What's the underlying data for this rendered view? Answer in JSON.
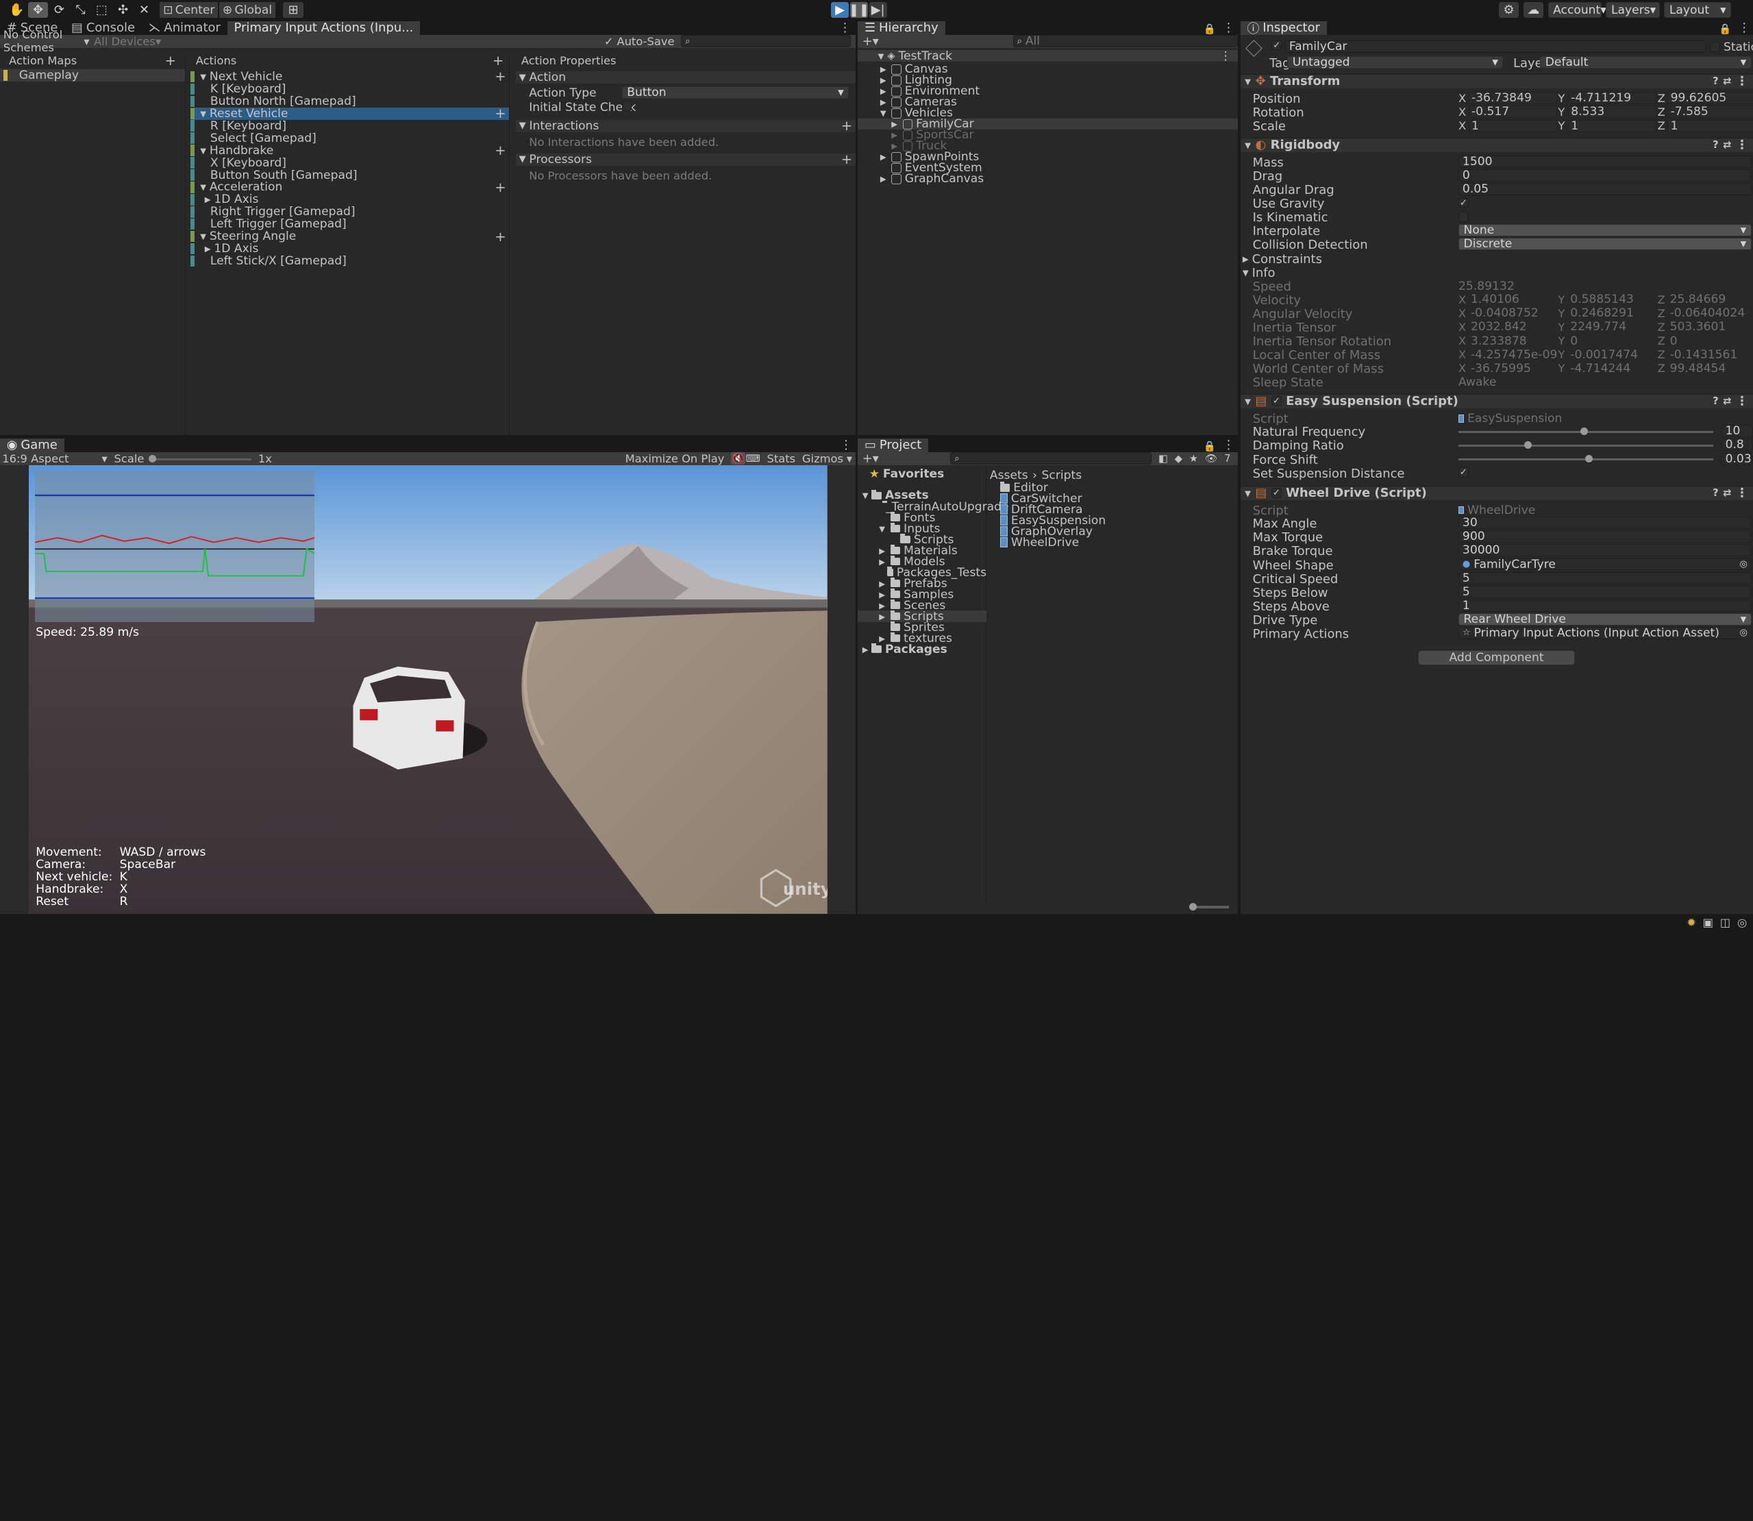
{
  "toolbar": {
    "center": "Center",
    "global": "Global",
    "account": "Account",
    "layers": "Layers",
    "layout": "Layout"
  },
  "tabs_top": {
    "scene": "Scene",
    "console": "Console",
    "animator": "Animator",
    "input_actions": "Primary Input Actions (Inpu..."
  },
  "input_editor": {
    "control_schemes": "No Control Schemes",
    "all_devices": "All Devices",
    "auto_save": "Auto-Save",
    "action_maps_header": "Action Maps",
    "actions_header": "Actions",
    "properties_header": "Action Properties",
    "action_map": "Gameplay",
    "actions": [
      {
        "t": "action",
        "label": "Next Vehicle"
      },
      {
        "t": "binding",
        "label": "K [Keyboard]"
      },
      {
        "t": "binding",
        "label": "Button North [Gamepad]"
      },
      {
        "t": "action",
        "label": "Reset Vehicle",
        "selected": true
      },
      {
        "t": "binding",
        "label": "R [Keyboard]"
      },
      {
        "t": "binding",
        "label": "Select [Gamepad]"
      },
      {
        "t": "action",
        "label": "Handbrake"
      },
      {
        "t": "binding",
        "label": "X [Keyboard]"
      },
      {
        "t": "binding",
        "label": "Button South [Gamepad]"
      },
      {
        "t": "action",
        "label": "Acceleration"
      },
      {
        "t": "composite",
        "label": "1D Axis"
      },
      {
        "t": "binding",
        "label": "Right Trigger [Gamepad]"
      },
      {
        "t": "binding",
        "label": "Left Trigger [Gamepad]"
      },
      {
        "t": "action",
        "label": "Steering Angle"
      },
      {
        "t": "composite",
        "label": "1D Axis"
      },
      {
        "t": "binding",
        "label": "Left Stick/X [Gamepad]"
      }
    ],
    "props": {
      "action_section": "Action",
      "action_type_label": "Action Type",
      "action_type_value": "Button",
      "initial_state_check": "Initial State Check",
      "interactions": "Interactions",
      "no_interactions": "No Interactions have been added.",
      "processors": "Processors",
      "no_processors": "No Processors have been added."
    }
  },
  "hierarchy": {
    "title": "Hierarchy",
    "search_placeholder": "All",
    "root": "TestTrack",
    "items": [
      "Canvas",
      "Lighting",
      "Environment",
      "Cameras",
      "Vehicles",
      "FamilyCar",
      "SportsCar",
      "Truck",
      "SpawnPoints",
      "EventSystem",
      "GraphCanvas"
    ]
  },
  "game": {
    "title": "Game",
    "aspect": "16:9 Aspect",
    "scale_label": "Scale",
    "scale_value": "1x",
    "maximize": "Maximize On Play",
    "stats": "Stats",
    "gizmos": "Gizmos",
    "speed": "Speed: 25.89 m/s",
    "controls": [
      [
        "Movement:",
        "WASD / arrows"
      ],
      [
        "Camera:",
        "SpaceBar"
      ],
      [
        "Next vehicle:",
        "K"
      ],
      [
        "Handbrake:",
        "X"
      ],
      [
        "Reset",
        "R"
      ]
    ],
    "watermark": "unity"
  },
  "project": {
    "title": "Project",
    "favorites": "Favorites",
    "assets": "Assets",
    "tree": [
      {
        "l": "_TerrainAutoUpgrade",
        "d": 1
      },
      {
        "l": "Fonts",
        "d": 1
      },
      {
        "l": "Inputs",
        "d": 1
      },
      {
        "l": "Scripts",
        "d": 2
      },
      {
        "l": "Materials",
        "d": 1
      },
      {
        "l": "Models",
        "d": 1
      },
      {
        "l": "Packages_Tests",
        "d": 1
      },
      {
        "l": "Prefabs",
        "d": 1
      },
      {
        "l": "Samples",
        "d": 1
      },
      {
        "l": "Scenes",
        "d": 1
      },
      {
        "l": "Scripts",
        "d": 1
      },
      {
        "l": "Sprites",
        "d": 1
      },
      {
        "l": "textures",
        "d": 1
      }
    ],
    "packages": "Packages",
    "breadcrumb_root": "Assets",
    "breadcrumb_leaf": "Scripts",
    "files": [
      {
        "l": "Editor",
        "k": "folder"
      },
      {
        "l": "CarSwitcher",
        "k": "script"
      },
      {
        "l": "DriftCamera",
        "k": "script"
      },
      {
        "l": "EasySuspension",
        "k": "script"
      },
      {
        "l": "GraphOverlay",
        "k": "script"
      },
      {
        "l": "WheelDrive",
        "k": "script"
      }
    ],
    "hidden_count": "7"
  },
  "inspector": {
    "title": "Inspector",
    "object_name": "FamilyCar",
    "static": "Static",
    "tag_label": "Tag",
    "tag": "Untagged",
    "layer_label": "Layer",
    "layer": "Default",
    "transform": {
      "title": "Transform",
      "position": [
        "-36.73849",
        "-4.711219",
        "99.62605"
      ],
      "rotation": [
        "-0.517",
        "8.533",
        "-7.585"
      ],
      "scale": [
        "1",
        "1",
        "1"
      ],
      "labels": [
        "Position",
        "Rotation",
        "Scale"
      ]
    },
    "rigidbody": {
      "title": "Rigidbody",
      "mass": "1500",
      "drag": "0",
      "angular_drag": "0.05",
      "interpolate": "None",
      "collision": "Discrete",
      "labels": {
        "mass": "Mass",
        "drag": "Drag",
        "angular_drag": "Angular Drag",
        "use_gravity": "Use Gravity",
        "is_kinematic": "Is Kinematic",
        "interpolate": "Interpolate",
        "collision": "Collision Detection",
        "constraints": "Constraints",
        "info": "Info"
      },
      "info": {
        "speed_label": "Speed",
        "speed": "25.89132",
        "rows": [
          {
            "l": "Velocity",
            "v": [
              "1.40106",
              "0.5885143",
              "25.84669"
            ]
          },
          {
            "l": "Angular Velocity",
            "v": [
              "-0.0408752",
              "0.2468291",
              "-0.06404024"
            ]
          },
          {
            "l": "Inertia Tensor",
            "v": [
              "2032.842",
              "2249.774",
              "503.3601"
            ]
          },
          {
            "l": "Inertia Tensor Rotation",
            "v": [
              "3.233878",
              "0",
              "0"
            ]
          },
          {
            "l": "Local Center of Mass",
            "v": [
              "-4.257475e-09",
              "-0.0017474",
              "-0.1431561"
            ]
          },
          {
            "l": "World Center of Mass",
            "v": [
              "-36.75995",
              "-4.714244",
              "99.48454"
            ]
          }
        ],
        "sleep_label": "Sleep State",
        "sleep": "Awake"
      }
    },
    "easy_suspension": {
      "title": "Easy Suspension (Script)",
      "script_label": "Script",
      "script": "EasySuspension",
      "sliders": [
        {
          "l": "Natural Frequency",
          "v": "10",
          "f": 0.49
        },
        {
          "l": "Damping Ratio",
          "v": "0.8",
          "f": 0.27
        },
        {
          "l": "Force Shift",
          "v": "0.03",
          "f": 0.51
        }
      ],
      "set_susp": "Set Suspension Distance"
    },
    "wheel_drive": {
      "title": "Wheel Drive (Script)",
      "script_label": "Script",
      "script": "WheelDrive",
      "fields": [
        [
          "Max Angle",
          "30"
        ],
        [
          "Max Torque",
          "900"
        ],
        [
          "Brake Torque",
          "30000"
        ]
      ],
      "wheel_shape_label": "Wheel Shape",
      "wheel_shape": "FamilyCarTyre",
      "fields2": [
        [
          "Critical Speed",
          "5"
        ],
        [
          "Steps Below",
          "5"
        ],
        [
          "Steps Above",
          "1"
        ]
      ],
      "drive_type_label": "Drive Type",
      "drive_type": "Rear Wheel Drive",
      "primary_label": "Primary Actions",
      "primary": "Primary Input Actions (Input Action Asset)"
    },
    "add_component": "Add Component"
  }
}
